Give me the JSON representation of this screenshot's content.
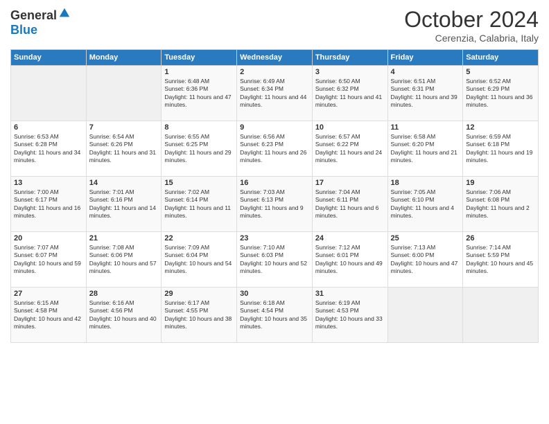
{
  "logo": {
    "general": "General",
    "blue": "Blue"
  },
  "title": "October 2024",
  "subtitle": "Cerenzia, Calabria, Italy",
  "days_of_week": [
    "Sunday",
    "Monday",
    "Tuesday",
    "Wednesday",
    "Thursday",
    "Friday",
    "Saturday"
  ],
  "weeks": [
    [
      {
        "day": "",
        "sunrise": "",
        "sunset": "",
        "daylight": ""
      },
      {
        "day": "",
        "sunrise": "",
        "sunset": "",
        "daylight": ""
      },
      {
        "day": "1",
        "sunrise": "Sunrise: 6:48 AM",
        "sunset": "Sunset: 6:36 PM",
        "daylight": "Daylight: 11 hours and 47 minutes."
      },
      {
        "day": "2",
        "sunrise": "Sunrise: 6:49 AM",
        "sunset": "Sunset: 6:34 PM",
        "daylight": "Daylight: 11 hours and 44 minutes."
      },
      {
        "day": "3",
        "sunrise": "Sunrise: 6:50 AM",
        "sunset": "Sunset: 6:32 PM",
        "daylight": "Daylight: 11 hours and 41 minutes."
      },
      {
        "day": "4",
        "sunrise": "Sunrise: 6:51 AM",
        "sunset": "Sunset: 6:31 PM",
        "daylight": "Daylight: 11 hours and 39 minutes."
      },
      {
        "day": "5",
        "sunrise": "Sunrise: 6:52 AM",
        "sunset": "Sunset: 6:29 PM",
        "daylight": "Daylight: 11 hours and 36 minutes."
      }
    ],
    [
      {
        "day": "6",
        "sunrise": "Sunrise: 6:53 AM",
        "sunset": "Sunset: 6:28 PM",
        "daylight": "Daylight: 11 hours and 34 minutes."
      },
      {
        "day": "7",
        "sunrise": "Sunrise: 6:54 AM",
        "sunset": "Sunset: 6:26 PM",
        "daylight": "Daylight: 11 hours and 31 minutes."
      },
      {
        "day": "8",
        "sunrise": "Sunrise: 6:55 AM",
        "sunset": "Sunset: 6:25 PM",
        "daylight": "Daylight: 11 hours and 29 minutes."
      },
      {
        "day": "9",
        "sunrise": "Sunrise: 6:56 AM",
        "sunset": "Sunset: 6:23 PM",
        "daylight": "Daylight: 11 hours and 26 minutes."
      },
      {
        "day": "10",
        "sunrise": "Sunrise: 6:57 AM",
        "sunset": "Sunset: 6:22 PM",
        "daylight": "Daylight: 11 hours and 24 minutes."
      },
      {
        "day": "11",
        "sunrise": "Sunrise: 6:58 AM",
        "sunset": "Sunset: 6:20 PM",
        "daylight": "Daylight: 11 hours and 21 minutes."
      },
      {
        "day": "12",
        "sunrise": "Sunrise: 6:59 AM",
        "sunset": "Sunset: 6:18 PM",
        "daylight": "Daylight: 11 hours and 19 minutes."
      }
    ],
    [
      {
        "day": "13",
        "sunrise": "Sunrise: 7:00 AM",
        "sunset": "Sunset: 6:17 PM",
        "daylight": "Daylight: 11 hours and 16 minutes."
      },
      {
        "day": "14",
        "sunrise": "Sunrise: 7:01 AM",
        "sunset": "Sunset: 6:16 PM",
        "daylight": "Daylight: 11 hours and 14 minutes."
      },
      {
        "day": "15",
        "sunrise": "Sunrise: 7:02 AM",
        "sunset": "Sunset: 6:14 PM",
        "daylight": "Daylight: 11 hours and 11 minutes."
      },
      {
        "day": "16",
        "sunrise": "Sunrise: 7:03 AM",
        "sunset": "Sunset: 6:13 PM",
        "daylight": "Daylight: 11 hours and 9 minutes."
      },
      {
        "day": "17",
        "sunrise": "Sunrise: 7:04 AM",
        "sunset": "Sunset: 6:11 PM",
        "daylight": "Daylight: 11 hours and 6 minutes."
      },
      {
        "day": "18",
        "sunrise": "Sunrise: 7:05 AM",
        "sunset": "Sunset: 6:10 PM",
        "daylight": "Daylight: 11 hours and 4 minutes."
      },
      {
        "day": "19",
        "sunrise": "Sunrise: 7:06 AM",
        "sunset": "Sunset: 6:08 PM",
        "daylight": "Daylight: 11 hours and 2 minutes."
      }
    ],
    [
      {
        "day": "20",
        "sunrise": "Sunrise: 7:07 AM",
        "sunset": "Sunset: 6:07 PM",
        "daylight": "Daylight: 10 hours and 59 minutes."
      },
      {
        "day": "21",
        "sunrise": "Sunrise: 7:08 AM",
        "sunset": "Sunset: 6:06 PM",
        "daylight": "Daylight: 10 hours and 57 minutes."
      },
      {
        "day": "22",
        "sunrise": "Sunrise: 7:09 AM",
        "sunset": "Sunset: 6:04 PM",
        "daylight": "Daylight: 10 hours and 54 minutes."
      },
      {
        "day": "23",
        "sunrise": "Sunrise: 7:10 AM",
        "sunset": "Sunset: 6:03 PM",
        "daylight": "Daylight: 10 hours and 52 minutes."
      },
      {
        "day": "24",
        "sunrise": "Sunrise: 7:12 AM",
        "sunset": "Sunset: 6:01 PM",
        "daylight": "Daylight: 10 hours and 49 minutes."
      },
      {
        "day": "25",
        "sunrise": "Sunrise: 7:13 AM",
        "sunset": "Sunset: 6:00 PM",
        "daylight": "Daylight: 10 hours and 47 minutes."
      },
      {
        "day": "26",
        "sunrise": "Sunrise: 7:14 AM",
        "sunset": "Sunset: 5:59 PM",
        "daylight": "Daylight: 10 hours and 45 minutes."
      }
    ],
    [
      {
        "day": "27",
        "sunrise": "Sunrise: 6:15 AM",
        "sunset": "Sunset: 4:58 PM",
        "daylight": "Daylight: 10 hours and 42 minutes."
      },
      {
        "day": "28",
        "sunrise": "Sunrise: 6:16 AM",
        "sunset": "Sunset: 4:56 PM",
        "daylight": "Daylight: 10 hours and 40 minutes."
      },
      {
        "day": "29",
        "sunrise": "Sunrise: 6:17 AM",
        "sunset": "Sunset: 4:55 PM",
        "daylight": "Daylight: 10 hours and 38 minutes."
      },
      {
        "day": "30",
        "sunrise": "Sunrise: 6:18 AM",
        "sunset": "Sunset: 4:54 PM",
        "daylight": "Daylight: 10 hours and 35 minutes."
      },
      {
        "day": "31",
        "sunrise": "Sunrise: 6:19 AM",
        "sunset": "Sunset: 4:53 PM",
        "daylight": "Daylight: 10 hours and 33 minutes."
      },
      {
        "day": "",
        "sunrise": "",
        "sunset": "",
        "daylight": ""
      },
      {
        "day": "",
        "sunrise": "",
        "sunset": "",
        "daylight": ""
      }
    ]
  ]
}
